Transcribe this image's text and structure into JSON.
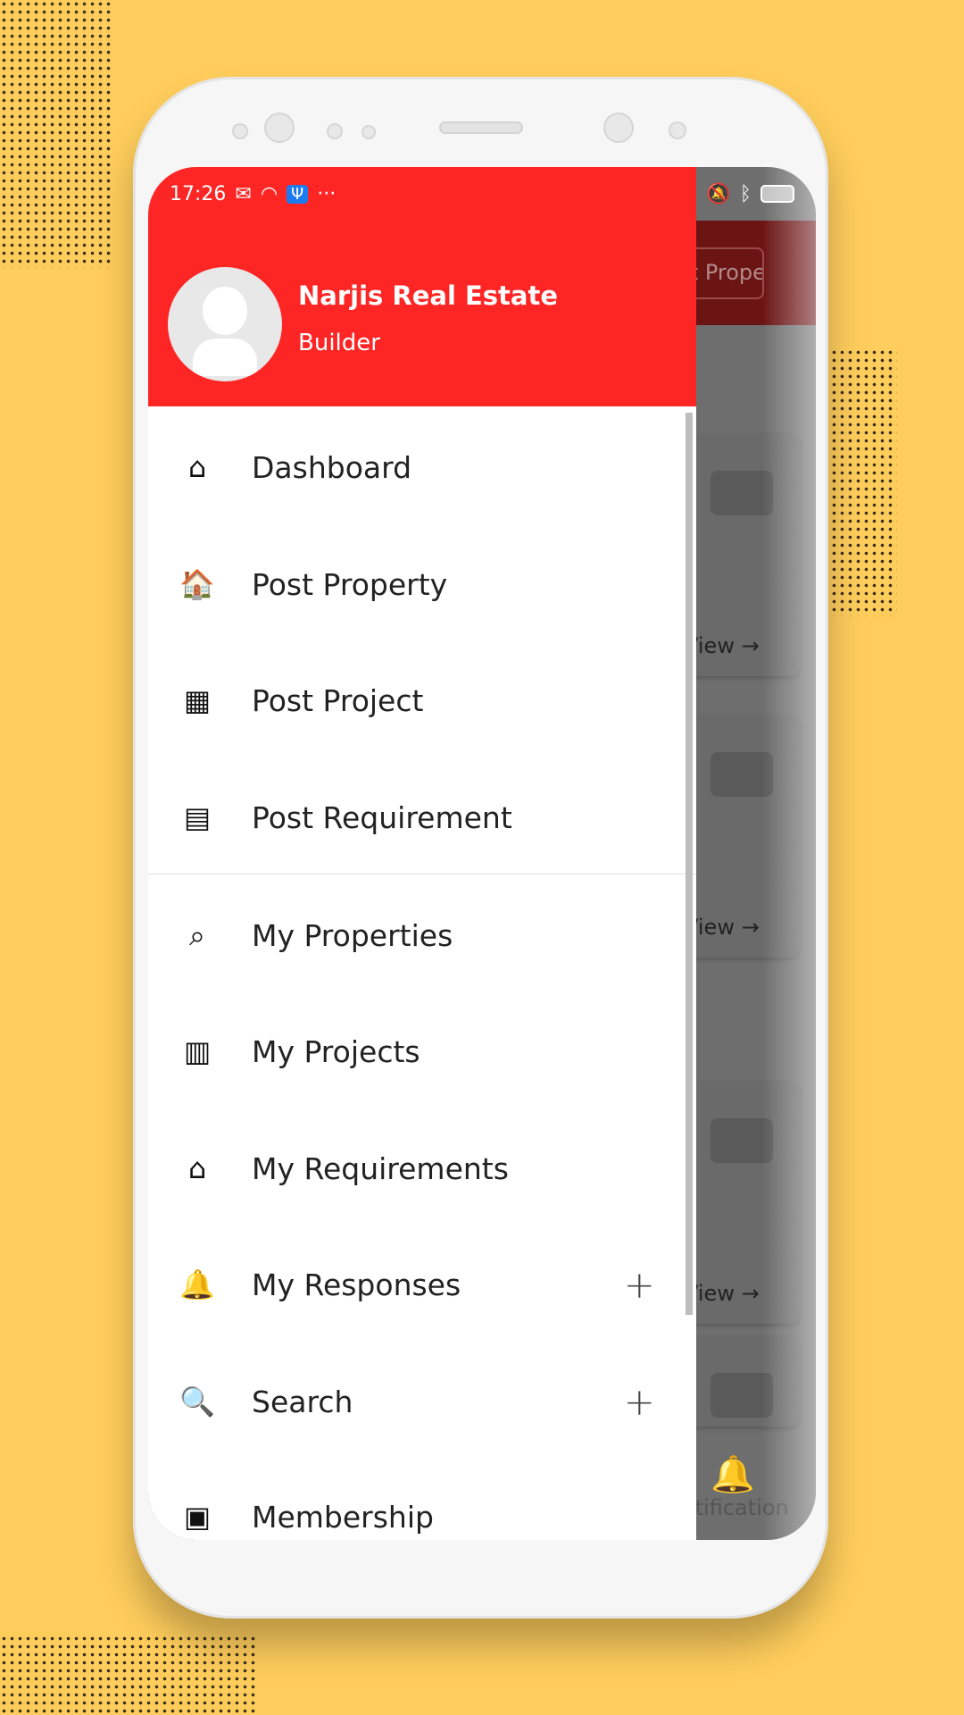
{
  "status_bar": {
    "time": "17:26",
    "more": "···"
  },
  "drawer": {
    "profile": {
      "name": "Narjis Real Estate",
      "role": "Builder"
    },
    "items": [
      {
        "label": "Dashboard",
        "icon": "home-icon",
        "glyph": "⌂"
      },
      {
        "label": "Post Property",
        "icon": "house-dollar-icon",
        "glyph": "🏠"
      },
      {
        "label": "Post Project",
        "icon": "blueprint-icon",
        "glyph": "▦"
      },
      {
        "label": "Post Requirement",
        "icon": "building-search-icon",
        "glyph": "▤"
      },
      {
        "label": "My Properties",
        "icon": "property-search-icon",
        "glyph": "⌕"
      },
      {
        "label": "My Projects",
        "icon": "projects-icon",
        "glyph": "▥"
      },
      {
        "label": "My Requirements",
        "icon": "house-search-icon",
        "glyph": "⌂"
      },
      {
        "label": "My Responses",
        "icon": "bell-icon",
        "glyph": "🔔",
        "expandable": true
      },
      {
        "label": "Search",
        "icon": "search-icon",
        "glyph": "🔍",
        "expandable": true
      },
      {
        "label": "Membership",
        "icon": "gift-card-icon",
        "glyph": "▣"
      }
    ],
    "expand_glyph": "+"
  },
  "background_screen": {
    "post_button": "Post Property",
    "card_link": "View →",
    "nav_notification": "Notification"
  },
  "colors": {
    "accent": "#FE2525",
    "background": "#FECD5C"
  }
}
